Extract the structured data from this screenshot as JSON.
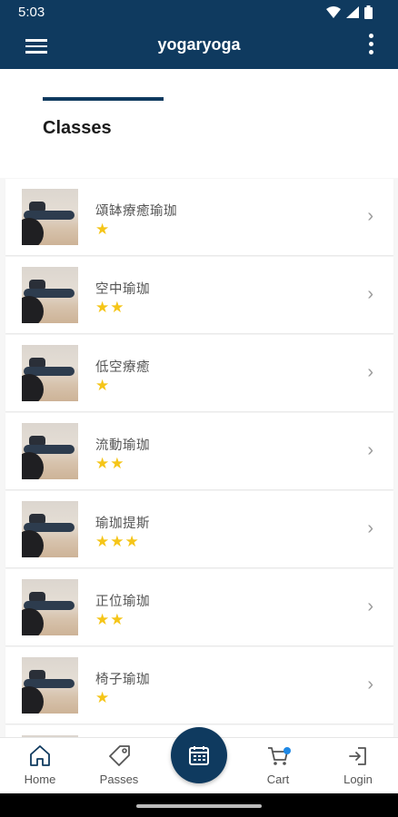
{
  "status_bar": {
    "time": "5:03"
  },
  "app_bar": {
    "title": "yogaryoga"
  },
  "page": {
    "title": "Classes"
  },
  "classes": [
    {
      "name": "頌缽療癒瑜珈",
      "stars": "★"
    },
    {
      "name": "空中瑜珈",
      "stars": "★★"
    },
    {
      "name": "低空療癒",
      "stars": "★"
    },
    {
      "name": "流動瑜珈",
      "stars": "★★"
    },
    {
      "name": "瑜珈提斯",
      "stars": "★★★"
    },
    {
      "name": "正位瑜珈",
      "stars": "★★"
    },
    {
      "name": "椅子瑜珈",
      "stars": "★"
    }
  ],
  "bottom_nav": {
    "home": "Home",
    "passes": "Passes",
    "cart": "Cart",
    "login": "Login"
  },
  "colors": {
    "primary": "#0f3a5f",
    "star": "#f5c518",
    "badge": "#1e88e5"
  }
}
